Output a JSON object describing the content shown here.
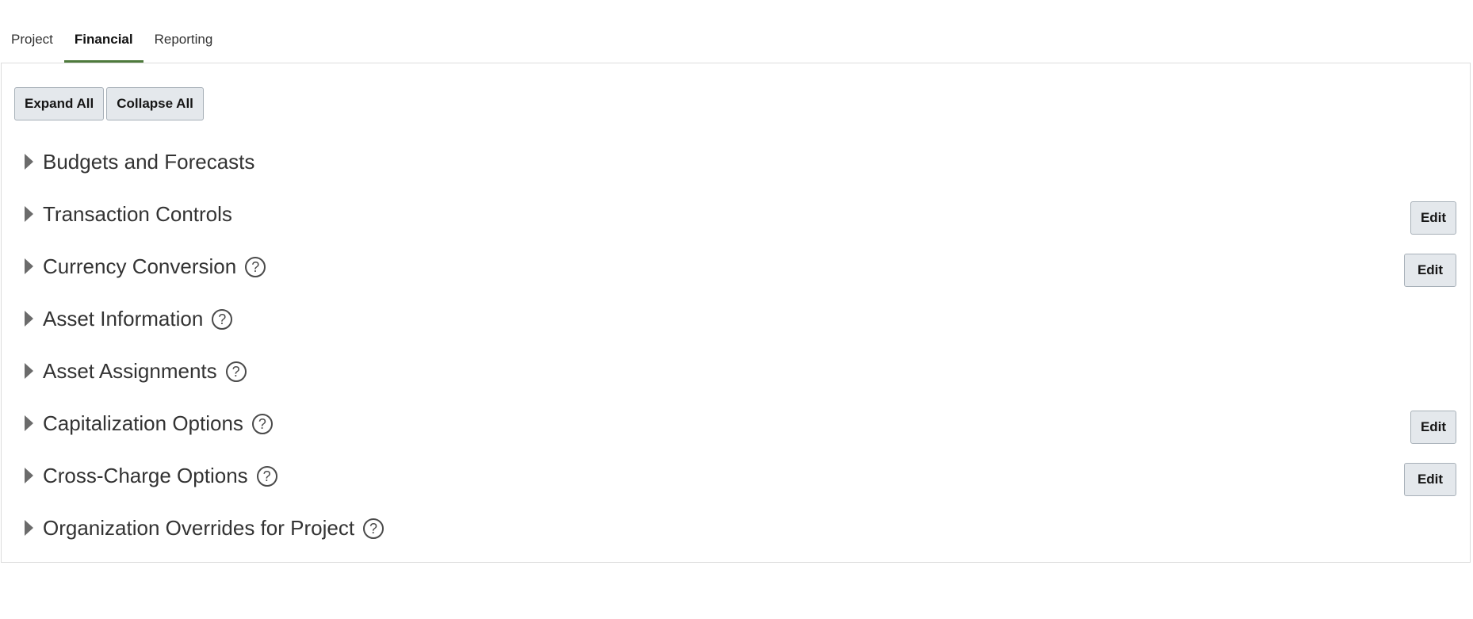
{
  "tabs": [
    {
      "label": "Project",
      "active": false
    },
    {
      "label": "Financial",
      "active": true
    },
    {
      "label": "Reporting",
      "active": false
    }
  ],
  "toolbar": {
    "expand_all": "Expand All",
    "collapse_all": "Collapse All"
  },
  "sections": [
    {
      "title": "Budgets and Forecasts",
      "help": false,
      "edit": null
    },
    {
      "title": "Transaction Controls",
      "help": false,
      "edit": "Edit"
    },
    {
      "title": "Currency Conversion",
      "help": true,
      "edit": "Edit"
    },
    {
      "title": "Asset Information",
      "help": true,
      "edit": null
    },
    {
      "title": "Asset Assignments",
      "help": true,
      "edit": null
    },
    {
      "title": "Capitalization Options",
      "help": true,
      "edit": "Edit"
    },
    {
      "title": "Cross-Charge Options",
      "help": true,
      "edit": "Edit"
    },
    {
      "title": "Organization Overrides for Project",
      "help": true,
      "edit": null
    }
  ],
  "icons": {
    "expand": "triangle-right-icon",
    "help": "question-circle-icon"
  },
  "colors": {
    "active_tab_underline": "#4e7a3c",
    "button_bg": "#e4e8ec",
    "button_border": "#a7b0b8"
  }
}
